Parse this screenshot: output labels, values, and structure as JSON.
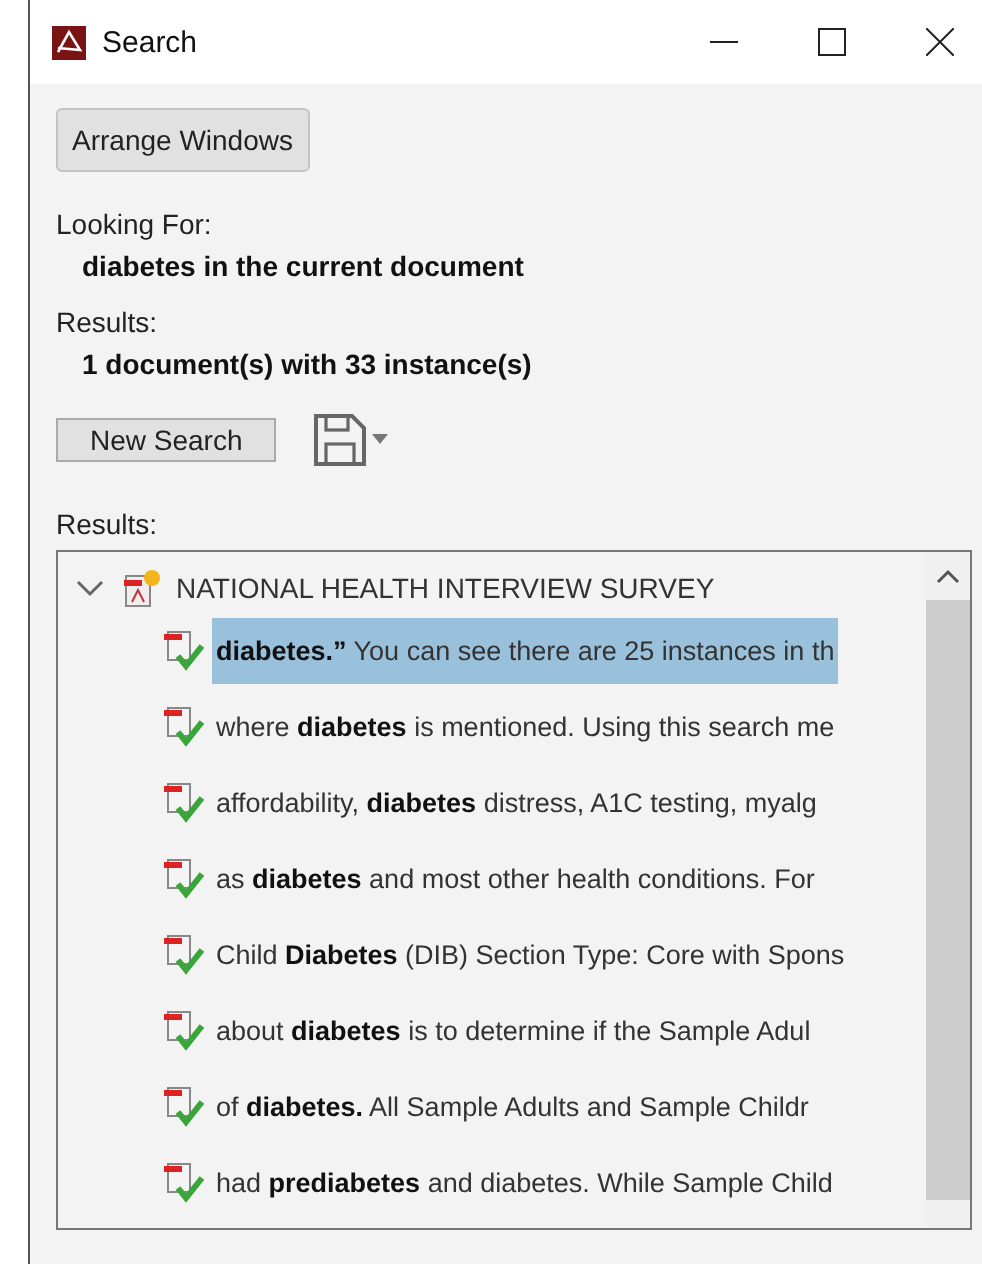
{
  "window": {
    "title": "Search"
  },
  "arrange_button": "Arrange Windows",
  "looking_for": {
    "label": "Looking For:",
    "value": "diabetes in the current document"
  },
  "summary": {
    "label": "Results:",
    "value": "1 document(s) with 33 instance(s)"
  },
  "new_search_button": "New Search",
  "results": {
    "label": "Results:",
    "document": {
      "title": "NATIONAL HEALTH INTERVIEW SURVEY",
      "expanded": true,
      "children": [
        {
          "text": "**diabetes.”** You can see there are 25 instances in th",
          "selected": true
        },
        {
          "text": "where **diabetes** is mentioned. Using this search me",
          "selected": false
        },
        {
          "text": "affordability, **diabetes** distress, A1C testing, myalg",
          "selected": false
        },
        {
          "text": "as **diabetes** and most other health conditions. For",
          "selected": false
        },
        {
          "text": "Child **Diabetes** (DIB) Section Type: Core with Spons",
          "selected": false
        },
        {
          "text": "about **diabetes** is to determine if the Sample Adul",
          "selected": false
        },
        {
          "text": "of **diabetes.** All Sample Adults and Sample Childr",
          "selected": false
        },
        {
          "text": "had **prediabetes** and diabetes. While Sample Child",
          "selected": false
        }
      ]
    }
  }
}
